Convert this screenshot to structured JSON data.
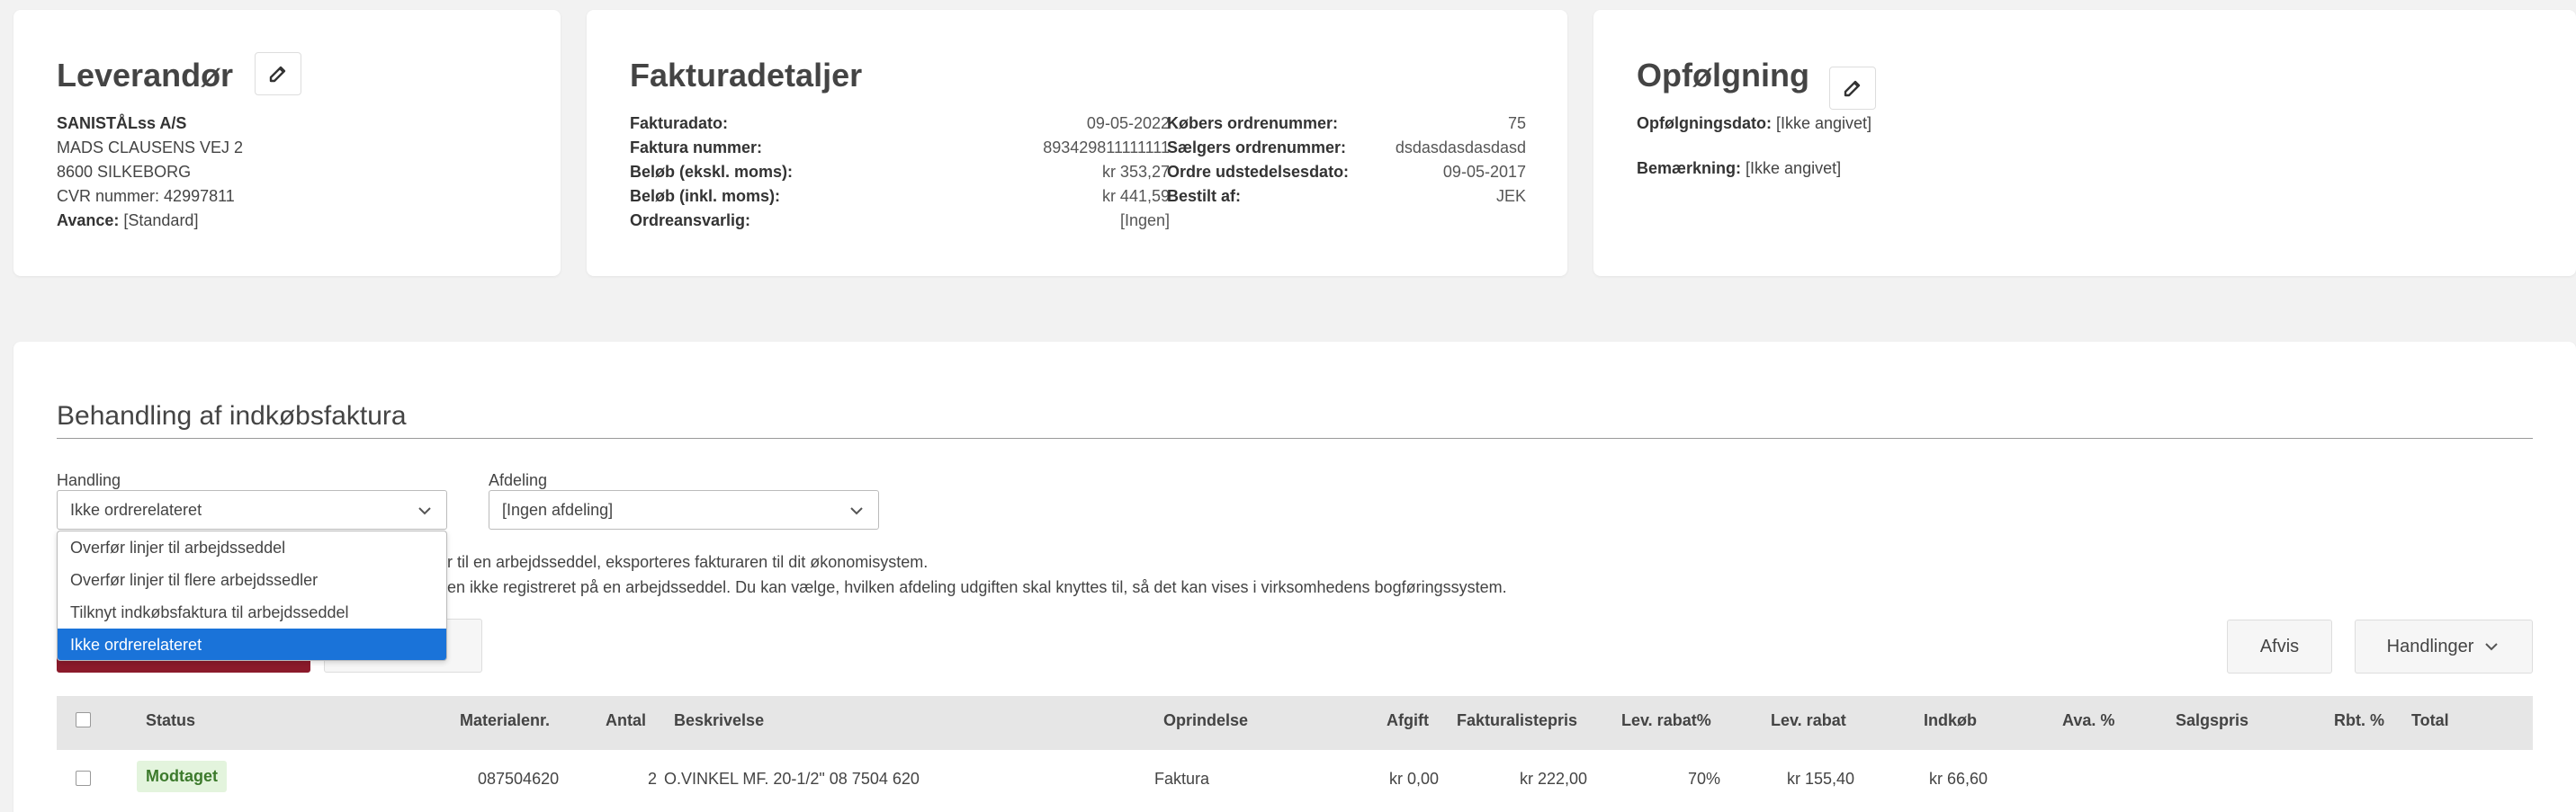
{
  "supplier": {
    "title": "Leverandør",
    "name": "SANISTÅLss A/S",
    "address1": "MADS CLAUSENS VEJ 2",
    "address2": "8600 SILKEBORG",
    "cvr_label": "CVR nummer:",
    "cvr_value": "42997811",
    "markup_label": "Avance:",
    "markup_value": "[Standard]",
    "edit_icon": "pencil-icon"
  },
  "invoice": {
    "title": "Fakturadetaljer",
    "left": [
      {
        "label": "Fakturadato:",
        "value": "09-05-2022"
      },
      {
        "label": "Faktura nummer:",
        "value": "893429811111111"
      },
      {
        "label": "Beløb (ekskl. moms):",
        "value": "kr 353,27"
      },
      {
        "label": "Beløb (inkl. moms):",
        "value": "kr 441,59"
      },
      {
        "label": "Ordreansvarlig:",
        "value": "[Ingen]"
      }
    ],
    "right": [
      {
        "label": "Købers ordrenummer:",
        "value": "75"
      },
      {
        "label": "Sælgers ordrenummer:",
        "value": "dsdasdasdasdasd"
      },
      {
        "label": "Ordre udstedelsesdato:",
        "value": "09-05-2017"
      },
      {
        "label": "Bestilt af:",
        "value": "JEK"
      }
    ]
  },
  "followup": {
    "title": "Opfølgning",
    "date_label": "Opfølgningsdato:",
    "date_value": "[Ikke angivet]",
    "note_label": "Bemærkning:",
    "note_value": "[Ikke angivet]",
    "edit_icon": "pencil-icon"
  },
  "processing": {
    "title": "Behandling af indkøbsfaktura",
    "action_label": "Handling",
    "action_value": "Ikke ordrerelateret",
    "department_label": "Afdeling",
    "department_value": "[Ingen afdeling]",
    "dropdown_options": [
      "Overfør linjer til arbejdsseddel",
      "Overfør linjer til flere arbejdssedler",
      "Tilknyt indkøbsfaktura til arbejdsseddel",
      "Ikke ordrerelateret"
    ],
    "info_line1": "jer til en arbejdsseddel, eksporteres fakturaren til dit økonomisystem.",
    "info_line2": "iften ikke registreret på en arbejdsseddel. Du kan vælge, hvilken afdeling udgiften skal knyttes til, så det kan vises i virksomhedens bogføringssystem.",
    "reject_label": "Afvis",
    "actions_label": "Handlinger",
    "accent_color": "#8b1a2b"
  },
  "table": {
    "headers": [
      "Status",
      "Materialenr.",
      "Antal",
      "Beskrivelse",
      "Oprindelse",
      "Afgift",
      "Fakturalistepris",
      "Lev. rabat%",
      "Lev. rabat",
      "Indkøb",
      "Ava. %",
      "Salgspris",
      "Rbt. %",
      "Total"
    ],
    "rows": [
      {
        "status": "Modtaget",
        "material": "087504620",
        "qty": "2",
        "description": "O.VINKEL MF. 20-1/2\" 08 7504 620",
        "origin": "Faktura",
        "fee": "kr 0,00",
        "list_price": "kr 222,00",
        "discount_pct": "70%",
        "discount": "kr 155,40",
        "purchase": "kr 66,60"
      }
    ]
  }
}
